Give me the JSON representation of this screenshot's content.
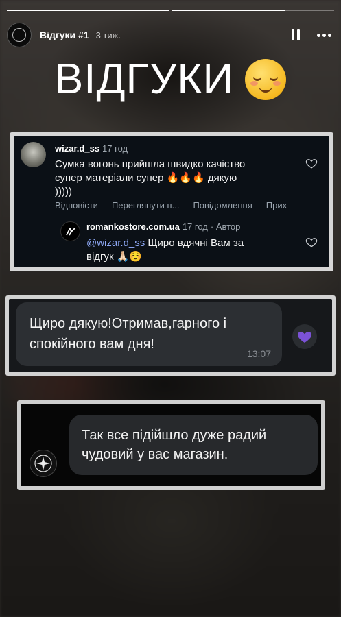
{
  "story": {
    "segments": [
      1.0,
      0.7
    ],
    "author_name": "Відгуки #1",
    "time_ago": "3 тиж."
  },
  "title": {
    "text": "ВІДГУКИ",
    "emoji": "smiling-face-icon"
  },
  "comments_card": {
    "comment": {
      "username": "wizar.d_ss",
      "time": "17 год",
      "text": "Сумка вогонь прийшла швидко качіство супер матеріали супер 🔥🔥🔥 дякую )))))",
      "actions": [
        "Відповісти",
        "Переглянути п...",
        "Повідомлення",
        "Прих"
      ]
    },
    "reply": {
      "username": "romankostore.com.ua",
      "time": "17 год",
      "badge": "· Автор",
      "mention": "@wizar.d_ss",
      "text": " Щиро вдячні Вам за відгук 🙏🏻☺️"
    }
  },
  "message_card": {
    "text": "Щиро дякую!Отримав,гарного і спокійного вам дня!",
    "timestamp": "13:07",
    "reaction": "purple-heart-icon"
  },
  "message_card2": {
    "text": "Так все підійшло дуже радий чудовий у вас магазин."
  },
  "colors": {
    "mention": "#8ea8f5",
    "reaction_heart": "#7b52d6"
  }
}
